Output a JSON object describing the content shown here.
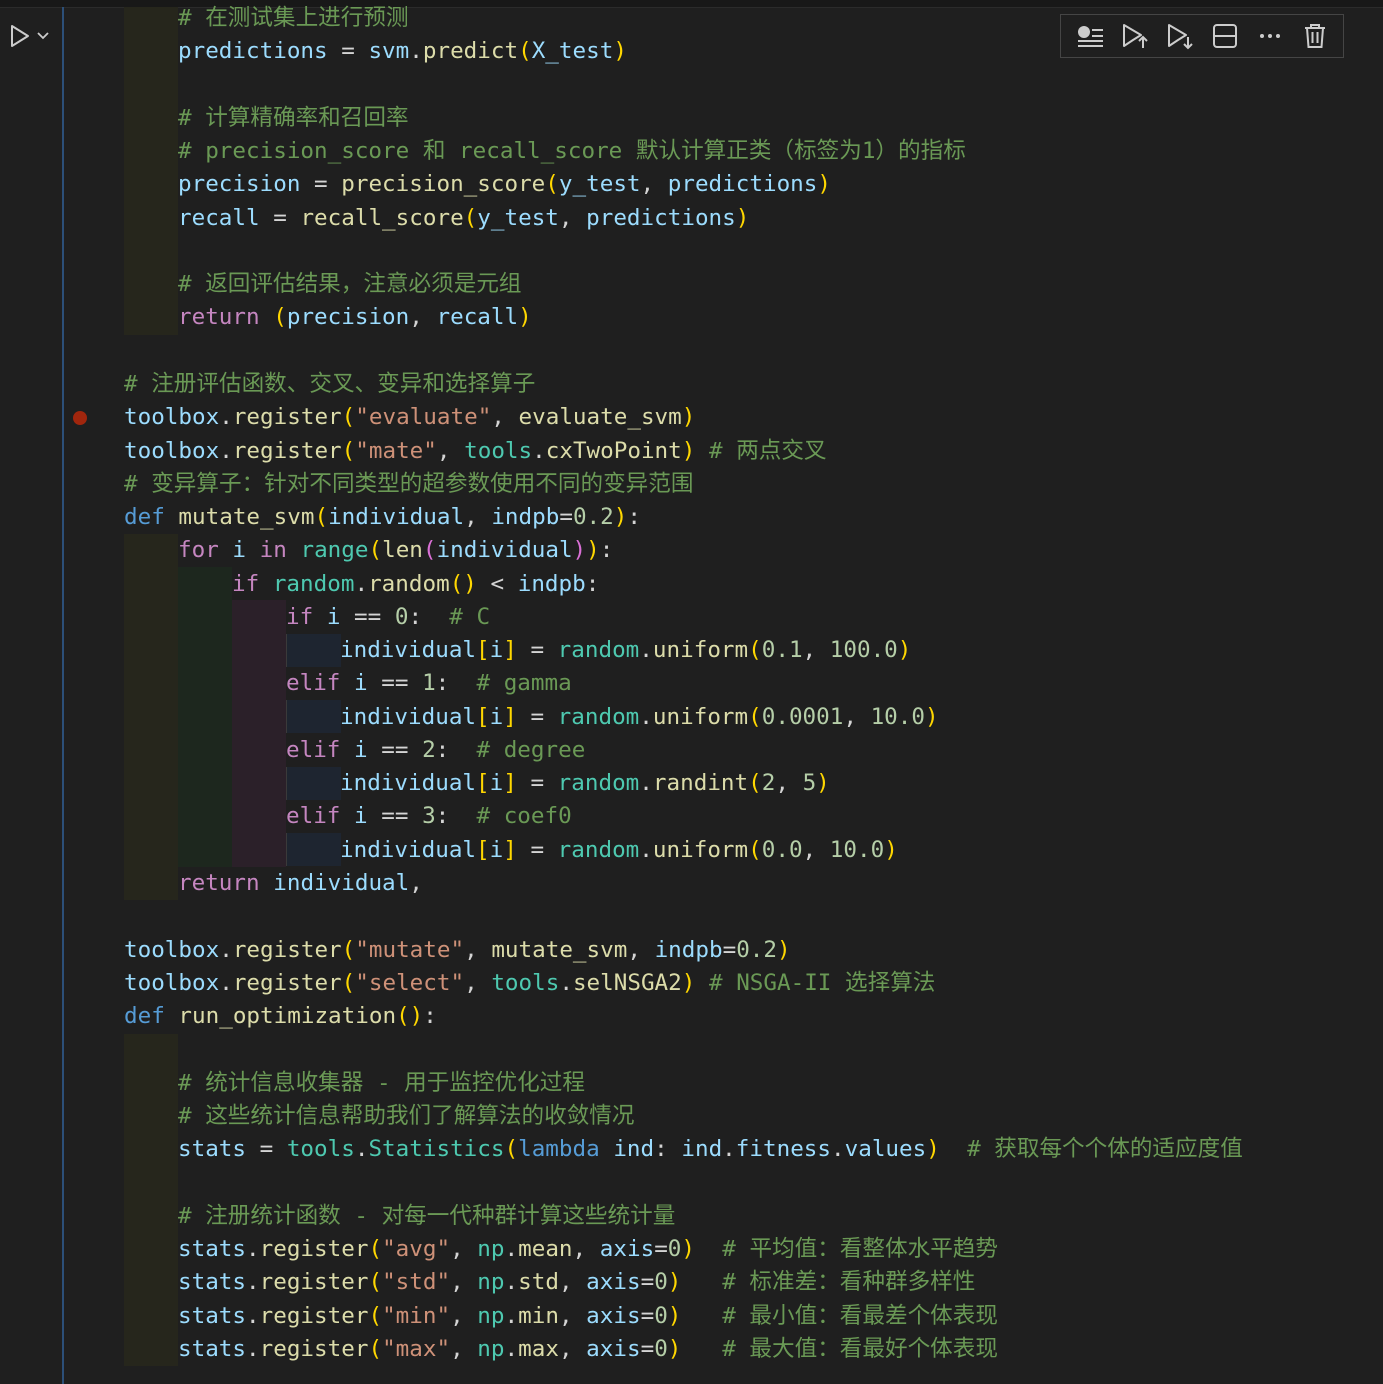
{
  "cell_toolbar": {
    "buttons": [
      {
        "name": "execute-above-icon",
        "title": "Execute above cells"
      },
      {
        "name": "execute-cell-and-below-icon",
        "title": "Execute cell and below"
      },
      {
        "name": "run-next-icon",
        "title": "Execute cell and below"
      },
      {
        "name": "split-cell-icon",
        "title": "Split cell"
      },
      {
        "name": "more-icon",
        "title": "More actions"
      },
      {
        "name": "delete-icon",
        "title": "Delete cell"
      }
    ]
  },
  "run_control": {
    "icons": [
      "play-icon",
      "chevron-down-icon"
    ]
  },
  "breakpoint_line": 13,
  "colors": {
    "background": "#1f1f1f",
    "keyword": "#c586c0",
    "def_keyword": "#569cd6",
    "function": "#dcdcaa",
    "variable": "#9cdcfe",
    "string": "#ce9178",
    "number": "#b5cea8",
    "comment": "#6a9955",
    "class": "#4ec9b0",
    "breakpoint": "#a1260d"
  },
  "code_lines": [
    {
      "tokens": [
        [
          "cm",
          "# 在测试集上进行预测"
        ]
      ]
    },
    {
      "tokens": [
        [
          "var",
          "predictions"
        ],
        [
          "op",
          " = "
        ],
        [
          "var",
          "svm"
        ],
        [
          "op",
          "."
        ],
        [
          "fn",
          "predict"
        ],
        [
          "p1",
          "("
        ],
        [
          "var",
          "X_test"
        ],
        [
          "p1",
          ")"
        ]
      ]
    },
    {
      "tokens": []
    },
    {
      "tokens": [
        [
          "cm",
          "# 计算精确率和召回率"
        ]
      ]
    },
    {
      "tokens": [
        [
          "cm",
          "# precision_score 和 recall_score 默认计算正类（标签为1）的指标"
        ]
      ]
    },
    {
      "tokens": [
        [
          "var",
          "precision"
        ],
        [
          "op",
          " = "
        ],
        [
          "fn",
          "precision_score"
        ],
        [
          "p1",
          "("
        ],
        [
          "var",
          "y_test"
        ],
        [
          "op",
          ", "
        ],
        [
          "var",
          "predictions"
        ],
        [
          "p1",
          ")"
        ]
      ]
    },
    {
      "tokens": [
        [
          "var",
          "recall"
        ],
        [
          "op",
          " = "
        ],
        [
          "fn",
          "recall_score"
        ],
        [
          "p1",
          "("
        ],
        [
          "var",
          "y_test"
        ],
        [
          "op",
          ", "
        ],
        [
          "var",
          "predictions"
        ],
        [
          "p1",
          ")"
        ]
      ]
    },
    {
      "tokens": []
    },
    {
      "tokens": [
        [
          "cm",
          "# 返回评估结果，注意必须是元组"
        ]
      ]
    },
    {
      "tokens": [
        [
          "kw",
          "return"
        ],
        [
          "op",
          " "
        ],
        [
          "p1",
          "("
        ],
        [
          "var",
          "precision"
        ],
        [
          "op",
          ", "
        ],
        [
          "var",
          "recall"
        ],
        [
          "p1",
          ")"
        ]
      ]
    },
    {
      "tokens": []
    },
    {
      "tokens": [
        [
          "cm",
          "# 注册评估函数、交叉、变异和选择算子"
        ]
      ]
    },
    {
      "tokens": [
        [
          "var",
          "toolbox"
        ],
        [
          "op",
          "."
        ],
        [
          "fn",
          "register"
        ],
        [
          "p1",
          "("
        ],
        [
          "str",
          "\"evaluate\""
        ],
        [
          "op",
          ", "
        ],
        [
          "fn",
          "evaluate_svm"
        ],
        [
          "p1",
          ")"
        ]
      ]
    },
    {
      "tokens": [
        [
          "var",
          "toolbox"
        ],
        [
          "op",
          "."
        ],
        [
          "fn",
          "register"
        ],
        [
          "p1",
          "("
        ],
        [
          "str",
          "\"mate\""
        ],
        [
          "op",
          ", "
        ],
        [
          "cls",
          "tools"
        ],
        [
          "op",
          "."
        ],
        [
          "fn",
          "cxTwoPoint"
        ],
        [
          "p1",
          ")"
        ],
        [
          "op",
          " "
        ],
        [
          "cm",
          "# 两点交叉"
        ]
      ]
    },
    {
      "tokens": [
        [
          "cm",
          "# 变异算子：针对不同类型的超参数使用不同的变异范围"
        ]
      ]
    },
    {
      "tokens": [
        [
          "def",
          "def"
        ],
        [
          "op",
          " "
        ],
        [
          "fn",
          "mutate_svm"
        ],
        [
          "p1",
          "("
        ],
        [
          "var",
          "individual"
        ],
        [
          "op",
          ", "
        ],
        [
          "var",
          "indpb"
        ],
        [
          "op",
          "="
        ],
        [
          "num",
          "0.2"
        ],
        [
          "p1",
          ")"
        ],
        [
          "op",
          ":"
        ]
      ]
    },
    {
      "tokens": [
        [
          "kw",
          "for"
        ],
        [
          "op",
          " "
        ],
        [
          "var",
          "i"
        ],
        [
          "op",
          " "
        ],
        [
          "kw",
          "in"
        ],
        [
          "op",
          " "
        ],
        [
          "cls",
          "range"
        ],
        [
          "p1",
          "("
        ],
        [
          "fn",
          "len"
        ],
        [
          "p2",
          "("
        ],
        [
          "var",
          "individual"
        ],
        [
          "p2",
          ")"
        ],
        [
          "p1",
          ")"
        ],
        [
          "op",
          ":"
        ]
      ]
    },
    {
      "tokens": [
        [
          "kw",
          "if"
        ],
        [
          "op",
          " "
        ],
        [
          "cls",
          "random"
        ],
        [
          "op",
          "."
        ],
        [
          "fn",
          "random"
        ],
        [
          "p1",
          "()"
        ],
        [
          "op",
          " < "
        ],
        [
          "var",
          "indpb"
        ],
        [
          "op",
          ":"
        ]
      ]
    },
    {
      "tokens": [
        [
          "kw",
          "if"
        ],
        [
          "op",
          " "
        ],
        [
          "var",
          "i"
        ],
        [
          "op",
          " == "
        ],
        [
          "num",
          "0"
        ],
        [
          "op",
          ":  "
        ],
        [
          "cm",
          "# C"
        ]
      ]
    },
    {
      "tokens": [
        [
          "var",
          "individual"
        ],
        [
          "p1",
          "["
        ],
        [
          "var",
          "i"
        ],
        [
          "p1",
          "]"
        ],
        [
          "op",
          " = "
        ],
        [
          "cls",
          "random"
        ],
        [
          "op",
          "."
        ],
        [
          "fn",
          "uniform"
        ],
        [
          "p1",
          "("
        ],
        [
          "num",
          "0.1"
        ],
        [
          "op",
          ", "
        ],
        [
          "num",
          "100.0"
        ],
        [
          "p1",
          ")"
        ]
      ]
    },
    {
      "tokens": [
        [
          "kw",
          "elif"
        ],
        [
          "op",
          " "
        ],
        [
          "var",
          "i"
        ],
        [
          "op",
          " == "
        ],
        [
          "num",
          "1"
        ],
        [
          "op",
          ":  "
        ],
        [
          "cm",
          "# gamma"
        ]
      ]
    },
    {
      "tokens": [
        [
          "var",
          "individual"
        ],
        [
          "p1",
          "["
        ],
        [
          "var",
          "i"
        ],
        [
          "p1",
          "]"
        ],
        [
          "op",
          " = "
        ],
        [
          "cls",
          "random"
        ],
        [
          "op",
          "."
        ],
        [
          "fn",
          "uniform"
        ],
        [
          "p1",
          "("
        ],
        [
          "num",
          "0.0001"
        ],
        [
          "op",
          ", "
        ],
        [
          "num",
          "10.0"
        ],
        [
          "p1",
          ")"
        ]
      ]
    },
    {
      "tokens": [
        [
          "kw",
          "elif"
        ],
        [
          "op",
          " "
        ],
        [
          "var",
          "i"
        ],
        [
          "op",
          " == "
        ],
        [
          "num",
          "2"
        ],
        [
          "op",
          ":  "
        ],
        [
          "cm",
          "# degree"
        ]
      ]
    },
    {
      "tokens": [
        [
          "var",
          "individual"
        ],
        [
          "p1",
          "["
        ],
        [
          "var",
          "i"
        ],
        [
          "p1",
          "]"
        ],
        [
          "op",
          " = "
        ],
        [
          "cls",
          "random"
        ],
        [
          "op",
          "."
        ],
        [
          "fn",
          "randint"
        ],
        [
          "p1",
          "("
        ],
        [
          "num",
          "2"
        ],
        [
          "op",
          ", "
        ],
        [
          "num",
          "5"
        ],
        [
          "p1",
          ")"
        ]
      ]
    },
    {
      "tokens": [
        [
          "kw",
          "elif"
        ],
        [
          "op",
          " "
        ],
        [
          "var",
          "i"
        ],
        [
          "op",
          " == "
        ],
        [
          "num",
          "3"
        ],
        [
          "op",
          ":  "
        ],
        [
          "cm",
          "# coef0"
        ]
      ]
    },
    {
      "tokens": [
        [
          "var",
          "individual"
        ],
        [
          "p1",
          "["
        ],
        [
          "var",
          "i"
        ],
        [
          "p1",
          "]"
        ],
        [
          "op",
          " = "
        ],
        [
          "cls",
          "random"
        ],
        [
          "op",
          "."
        ],
        [
          "fn",
          "uniform"
        ],
        [
          "p1",
          "("
        ],
        [
          "num",
          "0.0"
        ],
        [
          "op",
          ", "
        ],
        [
          "num",
          "10.0"
        ],
        [
          "p1",
          ")"
        ]
      ]
    },
    {
      "tokens": [
        [
          "kw",
          "return"
        ],
        [
          "op",
          " "
        ],
        [
          "var",
          "individual"
        ],
        [
          "op",
          ","
        ]
      ]
    },
    {
      "tokens": []
    },
    {
      "tokens": [
        [
          "var",
          "toolbox"
        ],
        [
          "op",
          "."
        ],
        [
          "fn",
          "register"
        ],
        [
          "p1",
          "("
        ],
        [
          "str",
          "\"mutate\""
        ],
        [
          "op",
          ", "
        ],
        [
          "fn",
          "mutate_svm"
        ],
        [
          "op",
          ", "
        ],
        [
          "var",
          "indpb"
        ],
        [
          "op",
          "="
        ],
        [
          "num",
          "0.2"
        ],
        [
          "p1",
          ")"
        ]
      ]
    },
    {
      "tokens": [
        [
          "var",
          "toolbox"
        ],
        [
          "op",
          "."
        ],
        [
          "fn",
          "register"
        ],
        [
          "p1",
          "("
        ],
        [
          "str",
          "\"select\""
        ],
        [
          "op",
          ", "
        ],
        [
          "cls",
          "tools"
        ],
        [
          "op",
          "."
        ],
        [
          "fn",
          "selNSGA2"
        ],
        [
          "p1",
          ")"
        ],
        [
          "op",
          " "
        ],
        [
          "cm",
          "# NSGA-II 选择算法"
        ]
      ]
    },
    {
      "tokens": [
        [
          "def",
          "def"
        ],
        [
          "op",
          " "
        ],
        [
          "fn",
          "run_optimization"
        ],
        [
          "p1",
          "()"
        ],
        [
          "op",
          ":"
        ]
      ]
    },
    {
      "tokens": []
    },
    {
      "tokens": [
        [
          "cm",
          "# 统计信息收集器 - 用于监控优化过程"
        ]
      ]
    },
    {
      "tokens": [
        [
          "cm",
          "# 这些统计信息帮助我们了解算法的收敛情况"
        ]
      ]
    },
    {
      "tokens": [
        [
          "var",
          "stats"
        ],
        [
          "op",
          " = "
        ],
        [
          "cls",
          "tools"
        ],
        [
          "op",
          "."
        ],
        [
          "cls",
          "Statistics"
        ],
        [
          "p1",
          "("
        ],
        [
          "def",
          "lambda"
        ],
        [
          "op",
          " "
        ],
        [
          "var",
          "ind"
        ],
        [
          "op",
          ": "
        ],
        [
          "var",
          "ind"
        ],
        [
          "op",
          "."
        ],
        [
          "var",
          "fitness"
        ],
        [
          "op",
          "."
        ],
        [
          "var",
          "values"
        ],
        [
          "p1",
          ")"
        ],
        [
          "op",
          "  "
        ],
        [
          "cm",
          "# 获取每个个体的适应度值"
        ]
      ]
    },
    {
      "tokens": []
    },
    {
      "tokens": [
        [
          "cm",
          "# 注册统计函数 - 对每一代种群计算这些统计量"
        ]
      ]
    },
    {
      "tokens": [
        [
          "var",
          "stats"
        ],
        [
          "op",
          "."
        ],
        [
          "fn",
          "register"
        ],
        [
          "p1",
          "("
        ],
        [
          "str",
          "\"avg\""
        ],
        [
          "op",
          ", "
        ],
        [
          "cls",
          "np"
        ],
        [
          "op",
          "."
        ],
        [
          "fn",
          "mean"
        ],
        [
          "op",
          ", "
        ],
        [
          "var",
          "axis"
        ],
        [
          "op",
          "="
        ],
        [
          "num",
          "0"
        ],
        [
          "p1",
          ")"
        ],
        [
          "op",
          "  "
        ],
        [
          "cm",
          "# 平均值：看整体水平趋势"
        ]
      ]
    },
    {
      "tokens": [
        [
          "var",
          "stats"
        ],
        [
          "op",
          "."
        ],
        [
          "fn",
          "register"
        ],
        [
          "p1",
          "("
        ],
        [
          "str",
          "\"std\""
        ],
        [
          "op",
          ", "
        ],
        [
          "cls",
          "np"
        ],
        [
          "op",
          "."
        ],
        [
          "fn",
          "std"
        ],
        [
          "op",
          ", "
        ],
        [
          "var",
          "axis"
        ],
        [
          "op",
          "="
        ],
        [
          "num",
          "0"
        ],
        [
          "p1",
          ")"
        ],
        [
          "op",
          "   "
        ],
        [
          "cm",
          "# 标准差：看种群多样性"
        ]
      ]
    },
    {
      "tokens": [
        [
          "var",
          "stats"
        ],
        [
          "op",
          "."
        ],
        [
          "fn",
          "register"
        ],
        [
          "p1",
          "("
        ],
        [
          "str",
          "\"min\""
        ],
        [
          "op",
          ", "
        ],
        [
          "cls",
          "np"
        ],
        [
          "op",
          "."
        ],
        [
          "fn",
          "min"
        ],
        [
          "op",
          ", "
        ],
        [
          "var",
          "axis"
        ],
        [
          "op",
          "="
        ],
        [
          "num",
          "0"
        ],
        [
          "p1",
          ")"
        ],
        [
          "op",
          "   "
        ],
        [
          "cm",
          "# 最小值：看最差个体表现"
        ]
      ]
    },
    {
      "tokens": [
        [
          "var",
          "stats"
        ],
        [
          "op",
          "."
        ],
        [
          "fn",
          "register"
        ],
        [
          "p1",
          "("
        ],
        [
          "str",
          "\"max\""
        ],
        [
          "op",
          ", "
        ],
        [
          "cls",
          "np"
        ],
        [
          "op",
          "."
        ],
        [
          "fn",
          "max"
        ],
        [
          "op",
          ", "
        ],
        [
          "var",
          "axis"
        ],
        [
          "op",
          "="
        ],
        [
          "num",
          "0"
        ],
        [
          "p1",
          ")"
        ],
        [
          "op",
          "   "
        ],
        [
          "cm",
          "# 最大值：看最好个体表现"
        ]
      ]
    }
  ]
}
